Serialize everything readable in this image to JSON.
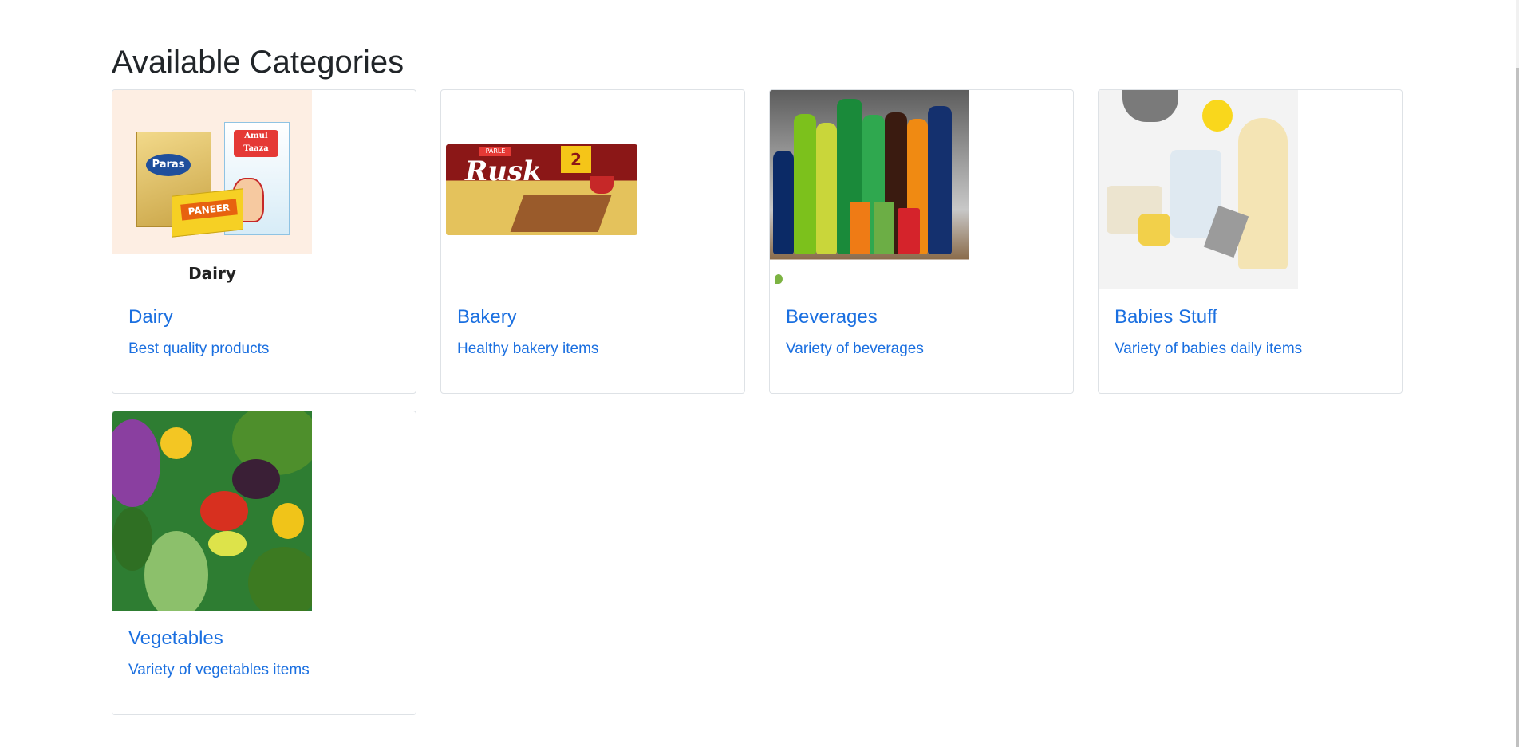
{
  "page": {
    "title": "Available Categories"
  },
  "categories": [
    {
      "name": "Dairy",
      "description": "Best quality products",
      "image": {
        "caption": "Dairy",
        "brand_labels": [
          "Paras",
          "Amul Taaza",
          "PANEER"
        ]
      }
    },
    {
      "name": "Bakery",
      "description": "Healthy bakery items",
      "image": {
        "brand_labels": [
          "PARLE",
          "Rusk",
          "2"
        ]
      }
    },
    {
      "name": "Beverages",
      "description": "Variety of beverages",
      "image": {}
    },
    {
      "name": "Babies Stuff",
      "description": "Variety of babies daily items",
      "image": {}
    },
    {
      "name": "Vegetables",
      "description": "Variety of vegetables items",
      "image": {}
    }
  ],
  "colors": {
    "link": "#1a6fe0",
    "title": "#212529",
    "card_border": "#dee2e6"
  }
}
